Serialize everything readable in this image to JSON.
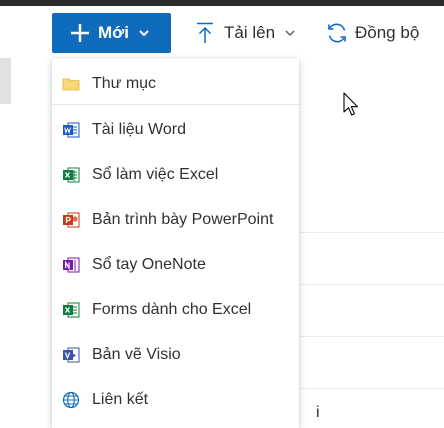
{
  "toolbar": {
    "new_label": "Mới",
    "upload_label": "Tải lên",
    "sync_label": "Đồng bộ"
  },
  "menu": {
    "items": [
      {
        "label": "Thư mục",
        "icon": "folder-icon"
      },
      {
        "label": "Tài liệu Word",
        "icon": "word-icon"
      },
      {
        "label": "Sổ làm việc Excel",
        "icon": "excel-icon"
      },
      {
        "label": "Bản trình bày PowerPoint",
        "icon": "powerpoint-icon"
      },
      {
        "label": "Sổ tay OneNote",
        "icon": "onenote-icon"
      },
      {
        "label": "Forms dành cho Excel",
        "icon": "forms-excel-icon"
      },
      {
        "label": "Bản vẽ Visio",
        "icon": "visio-icon"
      },
      {
        "label": "Liên kết",
        "icon": "globe-icon"
      }
    ]
  },
  "background": {
    "partial_text": "i"
  },
  "colors": {
    "accent": "#0f6cbd",
    "word": "#185abd",
    "excel": "#107c41",
    "powerpoint": "#c43e1c",
    "onenote": "#7719aa",
    "visio": "#3955a3",
    "folder": "#f8d775"
  }
}
